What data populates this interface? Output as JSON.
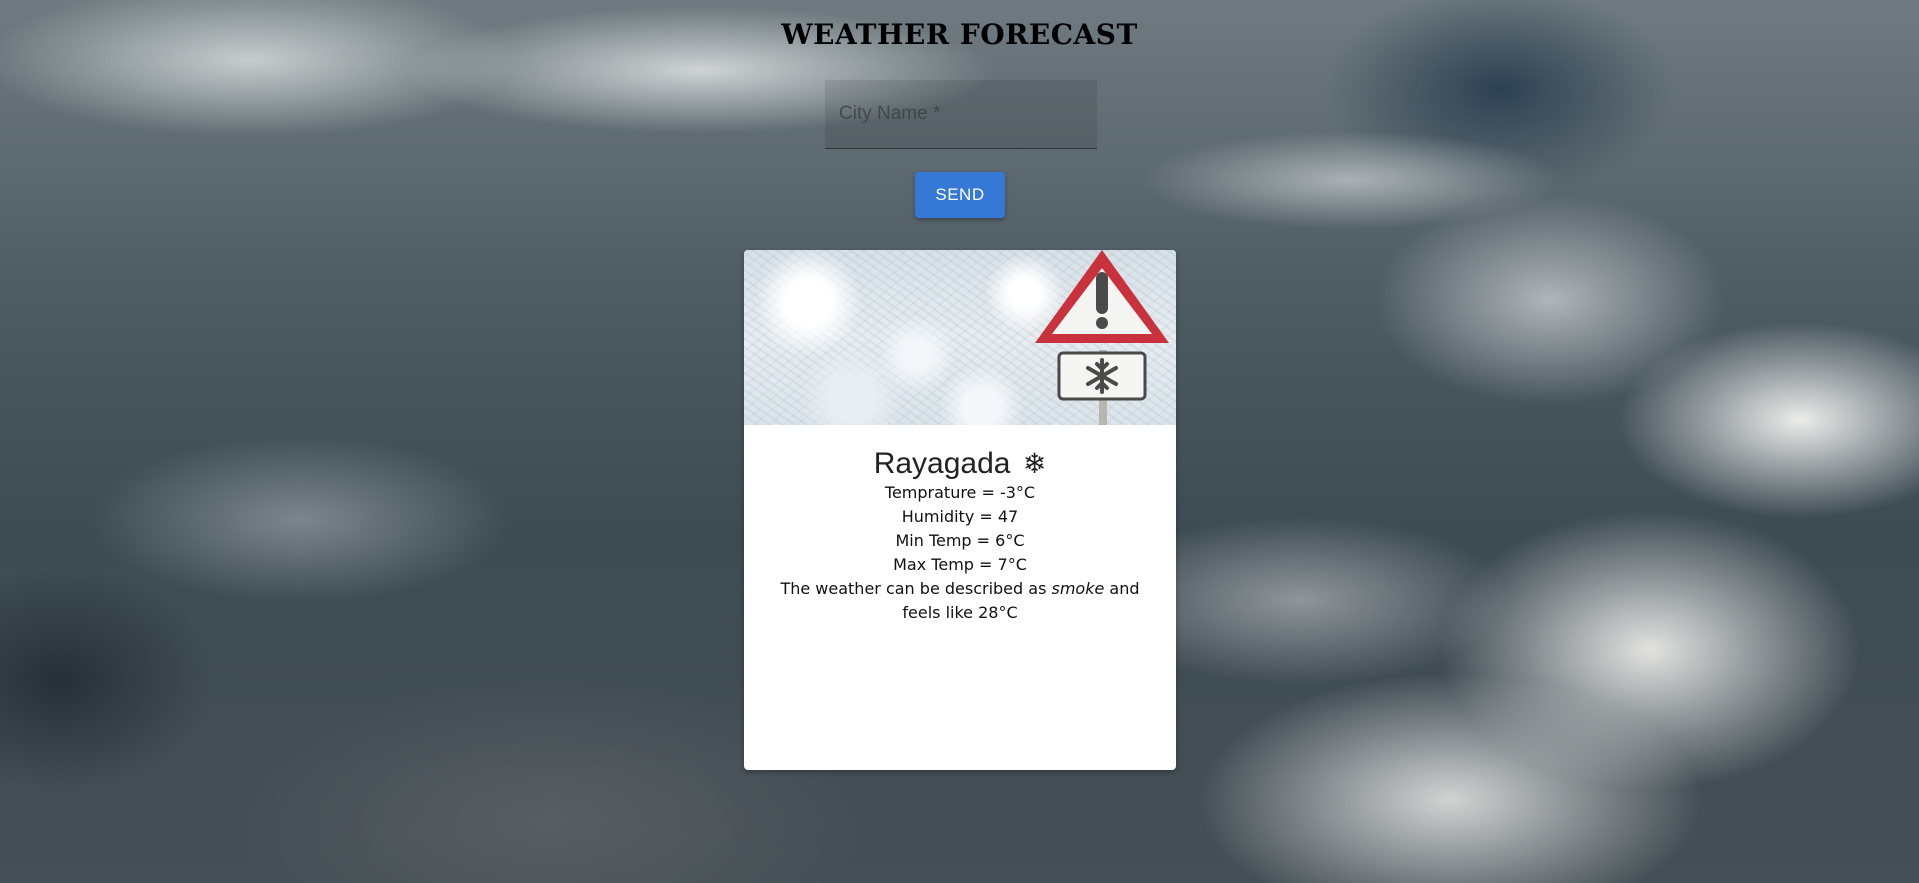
{
  "header": {
    "title": "WEATHER FORECAST"
  },
  "search": {
    "placeholder": "City Name *",
    "value": ""
  },
  "send_button": {
    "label": "SEND",
    "color": "#3578d6"
  },
  "card": {
    "image": {
      "description_icons": [
        "warning-sign-icon",
        "snowflake-icon"
      ]
    },
    "city": "Rayagada",
    "weather_icon": "❄",
    "temperature": "Temprature = -3°C",
    "humidity": "Humidity = 47",
    "min_temp": "Min Temp = 6°C",
    "max_temp": "Max Temp = 7°C",
    "description_prefix": "The weather can be described as",
    "description_value": "smoke",
    "description_mid": "and",
    "feels_like": "feels like 28°C"
  }
}
